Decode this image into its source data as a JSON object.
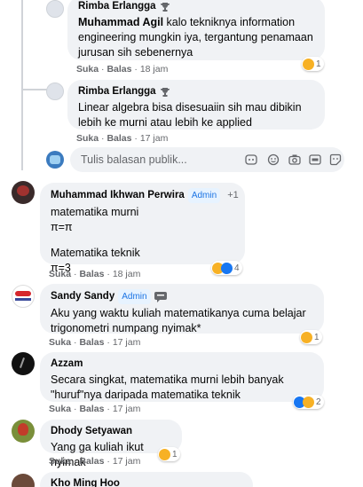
{
  "replies": [
    {
      "name": "Rimba Erlangga",
      "text": "Muhammad Agil kalo tekniknya information engineering mungkin iya, tergantung penamaan jurusan sih sebenernya",
      "mention": "Muhammad Agil",
      "rest": " kalo tekniknya information engineering mungkin iya, tergantung penamaan jurusan sih sebenernya",
      "like": "Suka",
      "reply": "Balas",
      "time": "18 jam",
      "reaction_count": "1"
    },
    {
      "name": "Rimba Erlangga",
      "text": "Linear algebra bisa disesuaiin sih mau dibikin lebih ke murni atau lebih ke applied",
      "like": "Suka",
      "reply": "Balas",
      "time": "17 jam"
    }
  ],
  "reply_box": {
    "placeholder": "Tulis balasan publik..."
  },
  "comments": [
    {
      "name": "Muhammad Ikhwan Perwira",
      "badge": "Admin",
      "extra": "+1",
      "lines": [
        "matematika murni",
        "π=π",
        "Matematika teknik",
        "π=3"
      ],
      "like": "Suka",
      "reply": "Balas",
      "time": "18 jam",
      "reaction_count": "4"
    },
    {
      "name": "Sandy Sandy",
      "badge": "Admin",
      "text": "Aku yang waktu kuliah matematikanya cuma belajar trigonometri numpang nyimak*",
      "like": "Suka",
      "reply": "Balas",
      "time": "17 jam",
      "reaction_count": "1"
    },
    {
      "name": "Azzam",
      "text": "Secara singkat, matematika murni lebih banyak \"huruf\"nya daripada matematika teknik",
      "like": "Suka",
      "reply": "Balas",
      "time": "17 jam",
      "reaction_count": "2"
    },
    {
      "name": "Dhody Setyawan",
      "text": "Yang ga kuliah ikut nyimak",
      "like": "Suka",
      "reply": "Balas",
      "time": "17 jam",
      "reaction_count": "1"
    },
    {
      "name": "Kho Ming Hoo"
    }
  ],
  "colors": {
    "bubble": "#f0f2f5",
    "meta": "#65676b",
    "admin_bg": "#e7f3ff",
    "admin_fg": "#1b74e4"
  }
}
